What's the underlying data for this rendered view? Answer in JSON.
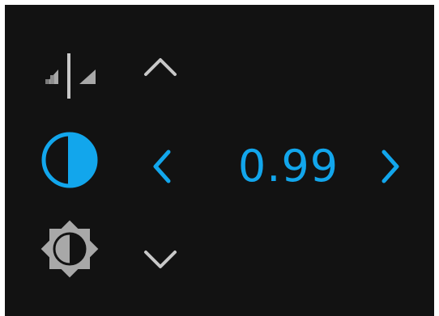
{
  "colors": {
    "background": "#121212",
    "accent": "#12a6ec",
    "icon_gray": "#a8a8a8",
    "chevron_gray": "#c8c8c8"
  },
  "controls": {
    "sharpness": {
      "icon": "sharpness-split-icon",
      "up_icon": "chevron-up-icon"
    },
    "contrast": {
      "icon": "contrast-half-circle-icon",
      "value": "0.99",
      "decrease_icon": "chevron-left-icon",
      "increase_icon": "chevron-right-icon"
    },
    "brightness": {
      "icon": "brightness-sun-icon",
      "down_icon": "chevron-down-icon"
    }
  }
}
